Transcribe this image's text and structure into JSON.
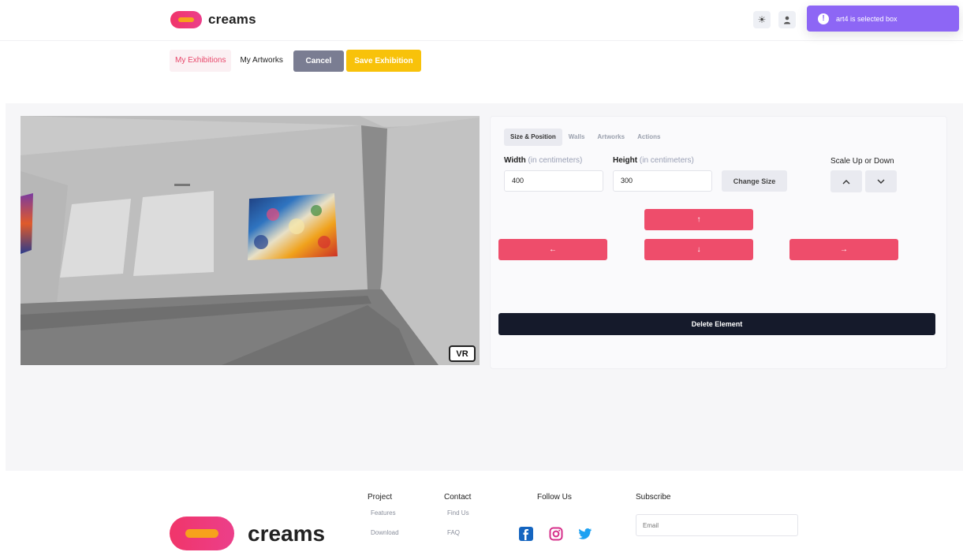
{
  "brand": {
    "name": "creams"
  },
  "header": {
    "theme_toggle_icon": "sun-icon",
    "profile_icon": "user-icon",
    "toast": {
      "icon": "info-icon",
      "text": "art4 is selected box"
    }
  },
  "topnav": {
    "my_exhibitions": "My Exhibitions",
    "my_artworks": "My Artworks",
    "cancel": "Cancel",
    "save_exhibition": "Save Exhibition"
  },
  "viewport": {
    "vr_label": "VR"
  },
  "panel": {
    "tabs": [
      {
        "label": "Size & Position",
        "active": true
      },
      {
        "label": "Walls",
        "active": false
      },
      {
        "label": "Artworks",
        "active": false
      },
      {
        "label": "Actions",
        "active": false
      }
    ],
    "width_label": "Width",
    "height_label": "Height",
    "unit_hint": "(in centimeters)",
    "width_value": "400",
    "height_value": "300",
    "change_size": "Change Size",
    "scale_label": "Scale Up or Down",
    "scale_up_icon": "chevron-up-icon",
    "scale_down_icon": "chevron-down-icon",
    "move_up": "↑",
    "move_left": "←",
    "move_down": "↓",
    "move_right": "→",
    "delete_element": "Delete Element"
  },
  "footer": {
    "project": {
      "title": "Project",
      "items": [
        "Features",
        "Download"
      ]
    },
    "contact": {
      "title": "Contact",
      "items": [
        "Find Us",
        "FAQ"
      ]
    },
    "follow": {
      "title": "Follow Us",
      "icons": [
        "facebook-icon",
        "instagram-icon",
        "twitter-icon"
      ]
    },
    "subscribe": {
      "title": "Subscribe",
      "email_placeholder": "Email"
    }
  },
  "colors": {
    "accent_pink": "#ee4d6b",
    "accent_yellow": "#f8c20a",
    "toast_purple": "#8d66f5",
    "dark": "#151a2b"
  }
}
